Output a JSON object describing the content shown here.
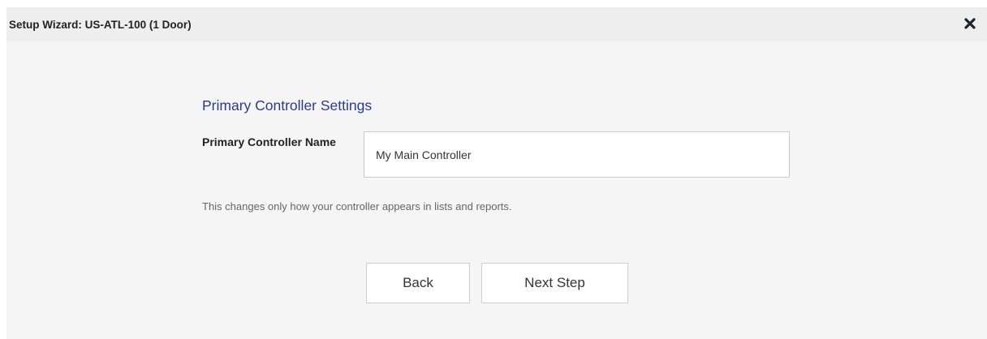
{
  "dialog": {
    "title": "Setup Wizard: US-ATL-100 (1 Door)",
    "close_icon": "close-icon"
  },
  "form": {
    "heading": "Primary Controller Settings",
    "controller_name_label": "Primary Controller Name",
    "controller_name_value": "My Main Controller",
    "help_text": "This changes only how your controller appears in lists and reports."
  },
  "buttons": {
    "back_label": "Back",
    "next_label": "Next Step"
  },
  "colors": {
    "heading": "#2d3a8c",
    "dialog_background": "#f5f5f5",
    "titlebar_background": "#eeeeee"
  }
}
